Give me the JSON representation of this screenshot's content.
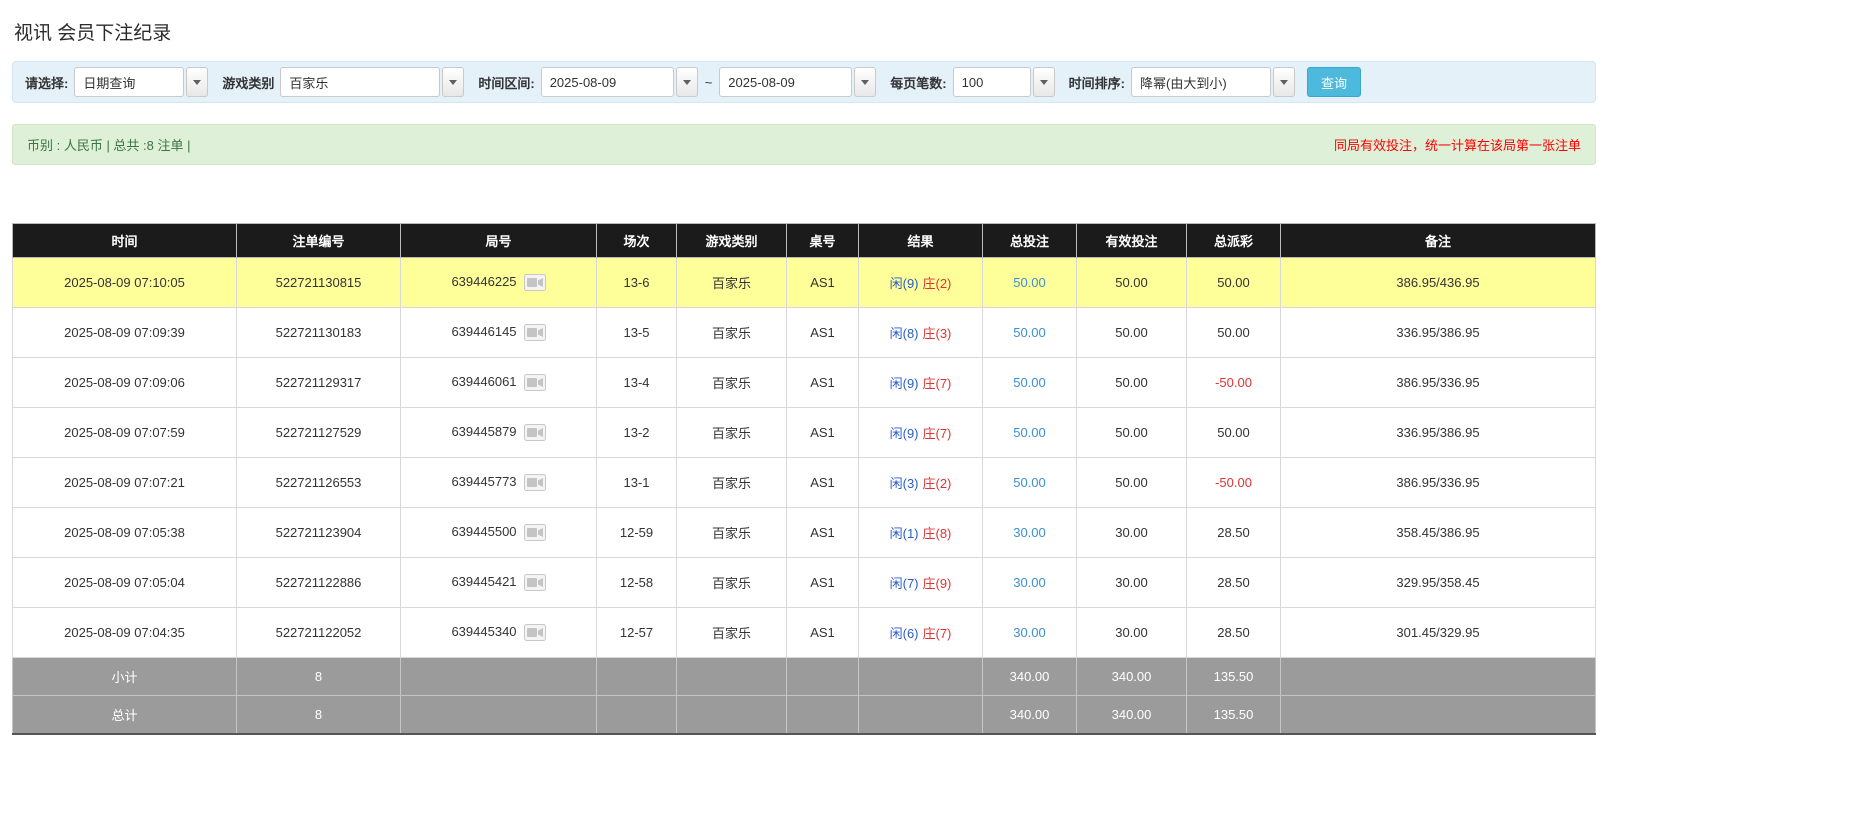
{
  "page": {
    "title": "视讯 会员下注纪录"
  },
  "filters": {
    "select_label": "请选择:",
    "select_value": "日期查询",
    "game_type_label": "游戏类别",
    "game_type_value": "百家乐",
    "date_range_label": "时间区间:",
    "date_from": "2025-08-09",
    "date_separator": "~",
    "date_to": "2025-08-09",
    "page_size_label": "每页笔数:",
    "page_size_value": "100",
    "sort_label": "时间排序:",
    "sort_value": "降幂(由大到小)",
    "search_button_label": "查询"
  },
  "summary_bar": {
    "left_text": "币别 : 人民币 | 总共 :8 注单 |",
    "right_text": "同局有效投注，统一计算在该局第一张注单"
  },
  "table": {
    "headers": [
      "时间",
      "注单编号",
      "局号",
      "场次",
      "游戏类别",
      "桌号",
      "结果",
      "总投注",
      "有效投注",
      "总派彩",
      "备注"
    ],
    "rows": [
      {
        "time": "2025-08-09 07:10:05",
        "bet_id": "522721130815",
        "round_id": "639446225",
        "session": "13-6",
        "game": "百家乐",
        "table_no": "AS1",
        "result_player": "闲(9)",
        "result_banker": "庄(2)",
        "total_bet": "50.00",
        "valid_bet": "50.00",
        "payout": "50.00",
        "note": "386.95/436.95",
        "highlighted": true
      },
      {
        "time": "2025-08-09 07:09:39",
        "bet_id": "522721130183",
        "round_id": "639446145",
        "session": "13-5",
        "game": "百家乐",
        "table_no": "AS1",
        "result_player": "闲(8)",
        "result_banker": "庄(3)",
        "total_bet": "50.00",
        "valid_bet": "50.00",
        "payout": "50.00",
        "note": "336.95/386.95",
        "highlighted": false
      },
      {
        "time": "2025-08-09 07:09:06",
        "bet_id": "522721129317",
        "round_id": "639446061",
        "session": "13-4",
        "game": "百家乐",
        "table_no": "AS1",
        "result_player": "闲(9)",
        "result_banker": "庄(7)",
        "total_bet": "50.00",
        "valid_bet": "50.00",
        "payout": "-50.00",
        "note": "386.95/336.95",
        "highlighted": false
      },
      {
        "time": "2025-08-09 07:07:59",
        "bet_id": "522721127529",
        "round_id": "639445879",
        "session": "13-2",
        "game": "百家乐",
        "table_no": "AS1",
        "result_player": "闲(9)",
        "result_banker": "庄(7)",
        "total_bet": "50.00",
        "valid_bet": "50.00",
        "payout": "50.00",
        "note": "336.95/386.95",
        "highlighted": false
      },
      {
        "time": "2025-08-09 07:07:21",
        "bet_id": "522721126553",
        "round_id": "639445773",
        "session": "13-1",
        "game": "百家乐",
        "table_no": "AS1",
        "result_player": "闲(3)",
        "result_banker": "庄(2)",
        "total_bet": "50.00",
        "valid_bet": "50.00",
        "payout": "-50.00",
        "note": "386.95/336.95",
        "highlighted": false
      },
      {
        "time": "2025-08-09 07:05:38",
        "bet_id": "522721123904",
        "round_id": "639445500",
        "session": "12-59",
        "game": "百家乐",
        "table_no": "AS1",
        "result_player": "闲(1)",
        "result_banker": "庄(8)",
        "total_bet": "30.00",
        "valid_bet": "30.00",
        "payout": "28.50",
        "note": "358.45/386.95",
        "highlighted": false
      },
      {
        "time": "2025-08-09 07:05:04",
        "bet_id": "522721122886",
        "round_id": "639445421",
        "session": "12-58",
        "game": "百家乐",
        "table_no": "AS1",
        "result_player": "闲(7)",
        "result_banker": "庄(9)",
        "total_bet": "30.00",
        "valid_bet": "30.00",
        "payout": "28.50",
        "note": "329.95/358.45",
        "highlighted": false
      },
      {
        "time": "2025-08-09 07:04:35",
        "bet_id": "522721122052",
        "round_id": "639445340",
        "session": "12-57",
        "game": "百家乐",
        "table_no": "AS1",
        "result_player": "闲(6)",
        "result_banker": "庄(7)",
        "total_bet": "30.00",
        "valid_bet": "30.00",
        "payout": "28.50",
        "note": "301.45/329.95",
        "highlighted": false
      }
    ],
    "subtotal_row": {
      "label": "小计",
      "count": "8",
      "total_bet": "340.00",
      "valid_bet": "340.00",
      "payout": "135.50"
    },
    "total_row": {
      "label": "总计",
      "count": "8",
      "total_bet": "340.00",
      "valid_bet": "340.00",
      "payout": "135.50"
    }
  },
  "colors": {
    "header_bg": "#1b1b1b",
    "highlight_yellow": "#ffff99",
    "footer_gray": "#9b9b9b",
    "filter_bar_bg": "#e4f1f9",
    "summary_bar_bg": "#dff0d8",
    "search_button_bg": "#4cb9dd",
    "link_blue": "#3c8fd4",
    "player_blue": "#2a5cc8",
    "banker_red": "#e03333",
    "negative_red": "#e03333",
    "notice_red": "#ff0000"
  }
}
